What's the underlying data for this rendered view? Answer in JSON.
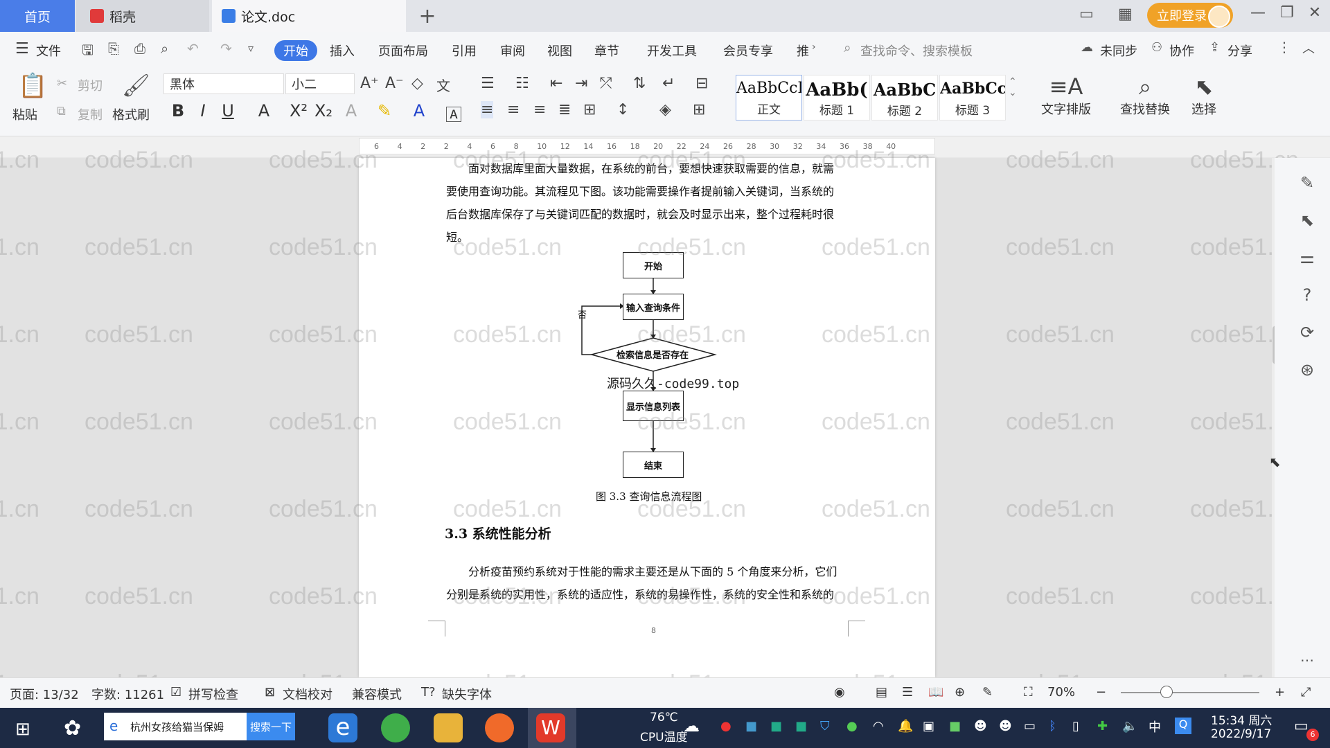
{
  "tabs": {
    "home": "首页",
    "docer": "稻壳",
    "document": "论文.doc",
    "add": "+"
  },
  "titlebar": {
    "login": "立即登录"
  },
  "menu": {
    "file": "文件",
    "items": [
      "开始",
      "插入",
      "页面布局",
      "引用",
      "审阅",
      "视图",
      "章节",
      "开发工具",
      "会员专享",
      "推"
    ],
    "search_command": "查找命令、搜索模板",
    "sync": "未同步",
    "collab": "协作",
    "share": "分享"
  },
  "ribbon": {
    "paste": "粘贴",
    "cut": "剪切",
    "copy": "复制",
    "format_painter": "格式刷",
    "font_name": "黑体",
    "font_size": "小二",
    "styles": [
      {
        "sample": "AaBbCcI",
        "name": "正文"
      },
      {
        "sample": "AaBb(",
        "name": "标题 1"
      },
      {
        "sample": "AaBbC",
        "name": "标题 2"
      },
      {
        "sample": "AaBbCcl",
        "name": "标题 3"
      }
    ],
    "text_layout": "文字排版",
    "find_replace": "查找替换",
    "select": "选择"
  },
  "ruler_ticks": [
    "6",
    "4",
    "2",
    "2",
    "4",
    "6",
    "8",
    "10",
    "12",
    "14",
    "16",
    "18",
    "20",
    "22",
    "24",
    "26",
    "28",
    "30",
    "32",
    "34",
    "36",
    "38",
    "40"
  ],
  "document": {
    "para1_line1": "面对数据库里面大量数据，在系统的前台，要想快速获取需要的信息，就需",
    "para1_line2": "要使用查询功能。其流程见下图。该功能需要操作者提前输入关键词，当系统的",
    "para1_line3": "后台数据库保存了与关键词匹配的数据时，就会及时显示出来，整个过程耗时很",
    "para1_line4": "短。",
    "flow": {
      "start": "开始",
      "input": "输入查询条件",
      "decision": "检索信息是否存在",
      "no": "否",
      "display": "显示信息列表",
      "end": "结束"
    },
    "overlay": "源码久久-code99.top",
    "figure_caption": "图 3.3  查询信息流程图",
    "section_title": "3.3 系统性能分析",
    "para2_line1": "分析疫苗预约系统对于性能的需求主要还是从下面的 5 个角度来分析，它们",
    "para2_line2": "分别是系统的实用性，系统的适应性，系统的易操作性，系统的安全性和系统的",
    "page_number": "8"
  },
  "watermark": "code51.cn",
  "statusbar": {
    "page": "页面: 13/32",
    "words": "字数: 11261",
    "spellcheck": "拼写检查",
    "proofread": "文档校对",
    "compat": "兼容模式",
    "missing_font": "缺失字体",
    "zoom": "70%"
  },
  "taskbar": {
    "search_text": "杭州女孩给猫当保姆",
    "search_button": "搜索一下",
    "temp": "76℃",
    "cpu": "CPU温度",
    "ime": "中",
    "time": "15:34 周六",
    "date": "2022/9/17",
    "notif_count": "6"
  },
  "colors": {
    "accent": "#3d77e6",
    "login": "#f0a227",
    "taskbar": "#1d2a44"
  }
}
